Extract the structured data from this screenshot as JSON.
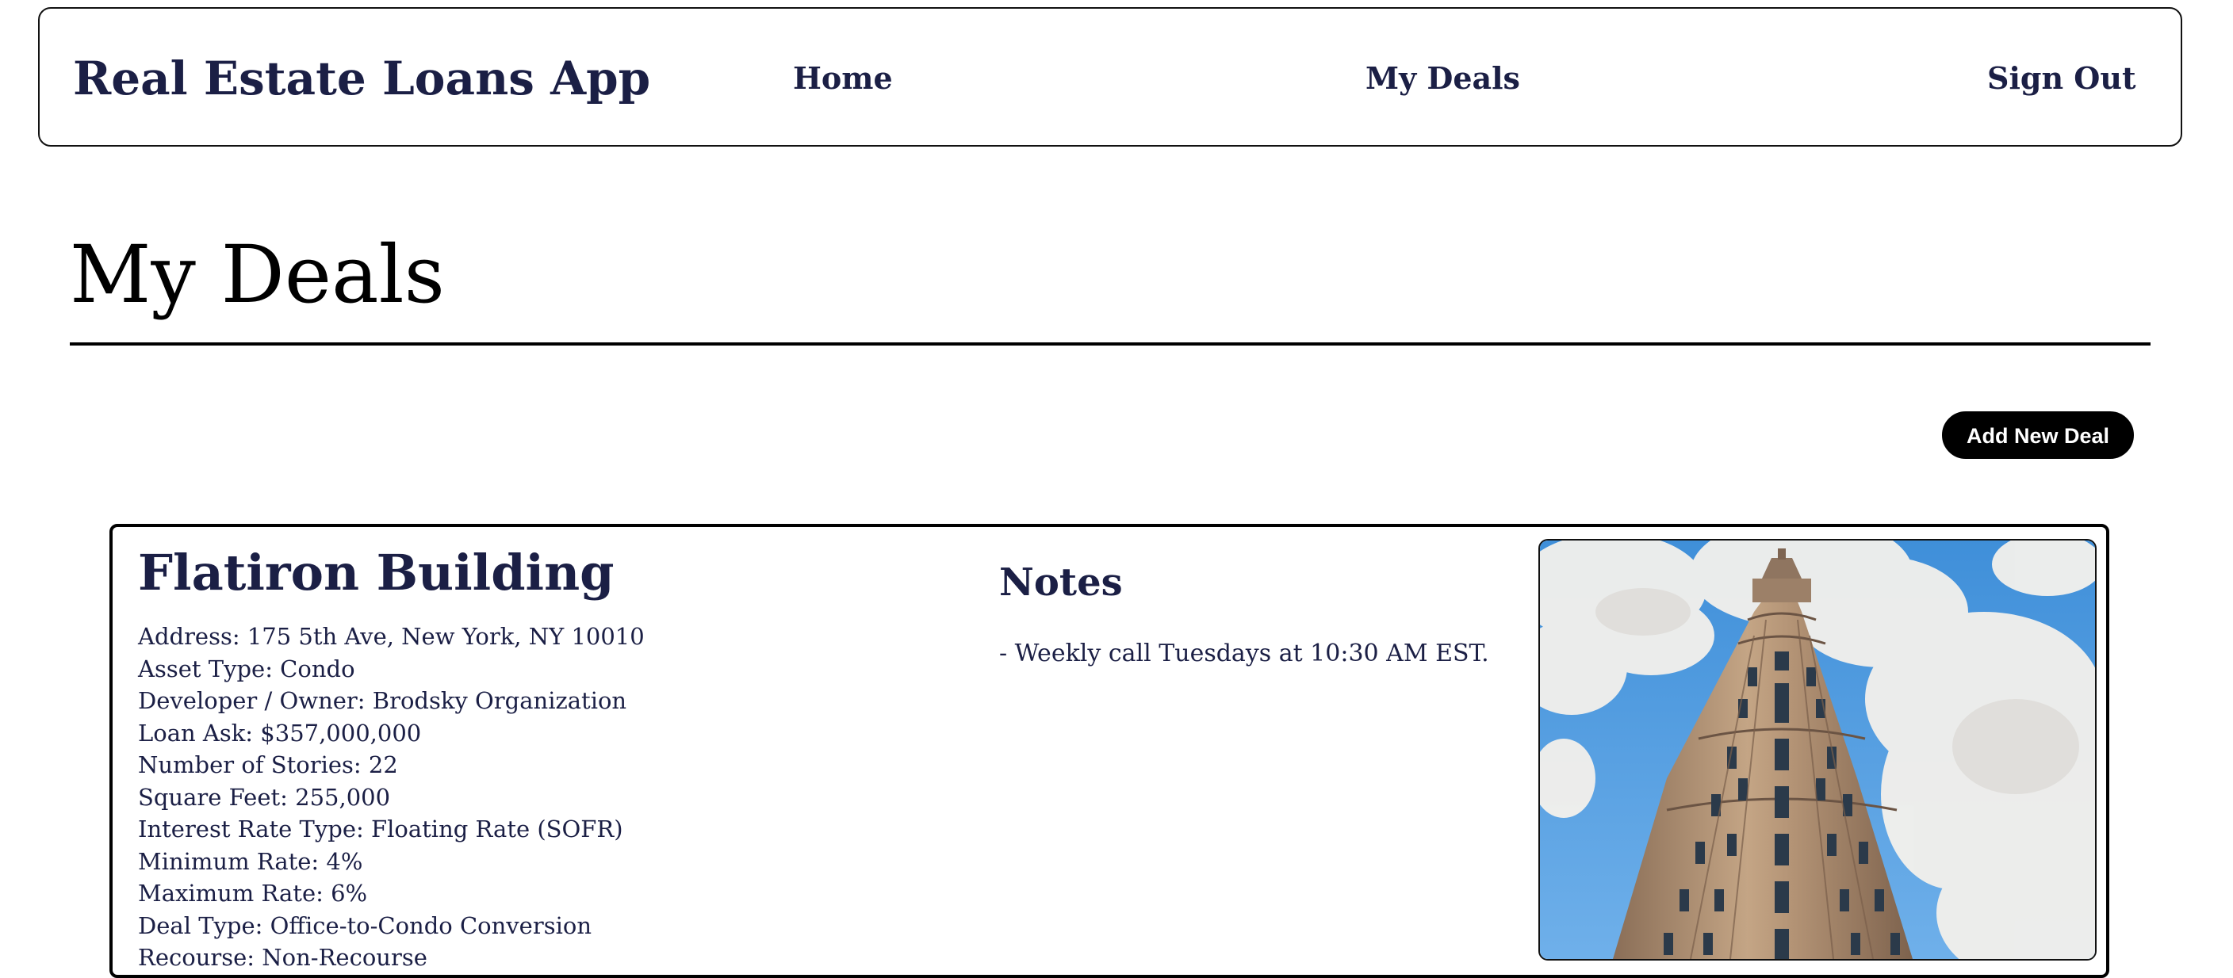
{
  "header": {
    "app_title": "Real Estate Loans App",
    "nav": {
      "home": "Home",
      "my_deals": "My Deals",
      "sign_out": "Sign Out"
    }
  },
  "main": {
    "page_title": "My Deals",
    "add_button_label": "Add New Deal"
  },
  "deals": [
    {
      "name": "Flatiron Building",
      "details": [
        "Address: 175 5th Ave, New York, NY 10010",
        "Asset Type: Condo",
        "Developer / Owner: Brodsky Organization",
        "Loan Ask: $357,000,000",
        "Number of Stories: 22",
        "Square Feet: 255,000",
        "Interest Rate Type: Floating Rate (SOFR)",
        "Minimum Rate: 4%",
        "Maximum Rate: 6%",
        "Deal Type: Office-to-Condo Conversion",
        "Recourse: Non-Recourse"
      ],
      "notes_title": "Notes",
      "notes": "- Weekly call Tuesdays at 10:30 AM EST.",
      "image_alt": "flatiron-building-photo"
    }
  ],
  "colors": {
    "brand_text": "#1b1f45",
    "button_bg": "#000000",
    "button_text": "#ffffff",
    "sky": "#4a9ae0",
    "building": "#b08f73"
  }
}
